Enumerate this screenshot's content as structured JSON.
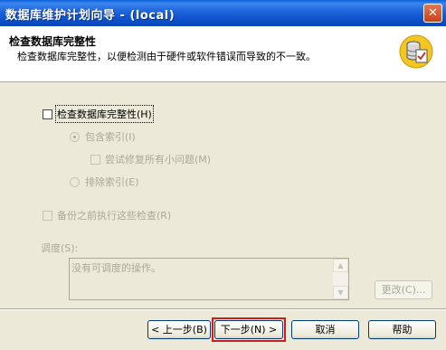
{
  "window": {
    "title": "数据库维护计划向导 - (local)",
    "close_glyph": "✕"
  },
  "header": {
    "title": "检查数据库完整性",
    "subtitle": "检查数据库完整性，以便检测由于硬件或软件错误而导致的不一致。"
  },
  "options": {
    "check_integrity": {
      "label": "检查数据库完整性(H)",
      "checked": false
    },
    "include_indexes": {
      "label": "包含索引(I)",
      "selected": true
    },
    "attempt_repair": {
      "label": "尝试修复所有小问题(M)",
      "checked": false
    },
    "exclude_indexes": {
      "label": "排除索引(E)",
      "selected": false
    },
    "check_before_backup": {
      "label": "备份之前执行这些检查(R)",
      "checked": false
    }
  },
  "schedule": {
    "label": "调度(S):",
    "text": "没有可调度的操作。",
    "change_button": "更改(C)..."
  },
  "buttons": {
    "back": "< 上一步(B)",
    "next": "下一步(N) >",
    "cancel": "取消",
    "help": "帮助"
  }
}
